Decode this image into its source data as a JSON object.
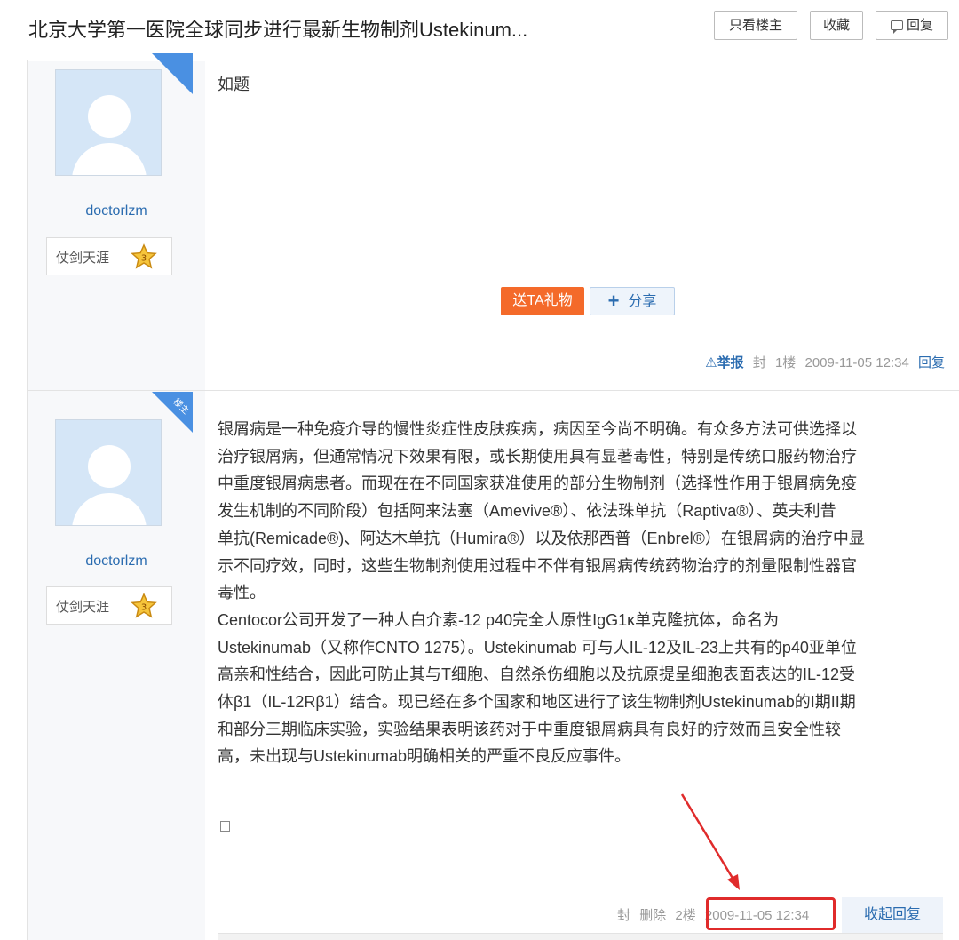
{
  "thread": {
    "title": "北京大学第一医院全球同步进行最新生物制剂Ustekinum...",
    "buttons": {
      "only_op": "只看楼主",
      "favorite": "收藏",
      "reply": "回复"
    }
  },
  "posts": [
    {
      "author": "doctorlzm",
      "level_title": "仗剑天涯",
      "level": "3",
      "ribbon": "",
      "content": [
        "如题"
      ],
      "gift_button": "送TA礼物",
      "share_button": "分享",
      "meta": {
        "report": "举报",
        "ban": "封",
        "floor": "1楼",
        "time": "2009-11-05 12:34",
        "reply": "回复"
      }
    },
    {
      "author": "doctorlzm",
      "level_title": "仗剑天涯",
      "level": "3",
      "ribbon": "楼主",
      "content": [
        "银屑病是一种免疫介导的慢性炎症性皮肤疾病，病因至今尚不明确。有众多方法可供选择以",
        "治疗银屑病，但通常情况下效果有限，或长期使用具有显著毒性，特别是传统口服药物治疗",
        "中重度银屑病患者。而现在在不同国家获准使用的部分生物制剂（选择性作用于银屑病免疫",
        "发生机制的不同阶段）包括阿来法塞（Amevive®）、依法珠单抗（Raptiva®）、英夫利昔",
        "单抗(Remicade®)、阿达木单抗（Humira®）以及依那西普（Enbrel®）在银屑病的治疗中显",
        "示不同疗效，同时，这些生物制剂使用过程中不伴有银屑病传统药物治疗的剂量限制性器官",
        "毒性。",
        "Centocor公司开发了一种人白介素-12 p40完全人原性IgG1κ单克隆抗体，命名为",
        "Ustekinumab（又称作CNTO 1275）。Ustekinumab 可与人IL-12及IL-23上共有的p40亚单位",
        "高亲和性结合，因此可防止其与T细胞、自然杀伤细胞以及抗原提呈细胞表面表达的IL-12受",
        "体β1（IL-12Rβ1）结合。现已经在多个国家和地区进行了该生物制剂Ustekinumab的I期II期",
        "和部分三期临床实验，实验结果表明该药对于中重度银屑病具有良好的疗效而且安全性较",
        "高，未出现与Ustekinumab明确相关的严重不良反应事件。"
      ],
      "meta": {
        "ban": "封",
        "delete": "删除",
        "floor": "2楼",
        "time": "2009-11-05 12:34",
        "fold_reply": "收起回复"
      }
    }
  ],
  "colors": {
    "accent": "#2b6cb0",
    "gift": "#f46a2a",
    "highlight": "#e02b2b"
  }
}
